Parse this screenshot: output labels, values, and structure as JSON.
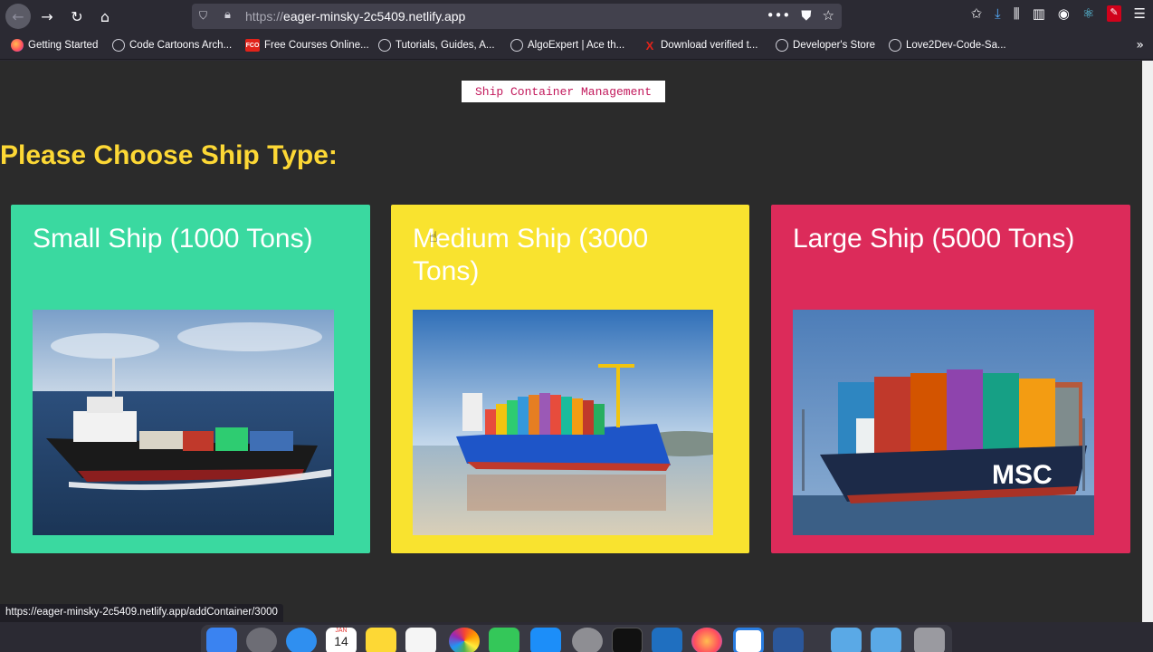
{
  "browser": {
    "url_prefix": "https://",
    "url_host": "eager-minsky-2c5409.netlify.app",
    "url_actions": [
      "•••",
      "pocket-icon",
      "star-icon"
    ]
  },
  "bookmarks": [
    {
      "label": "Getting Started",
      "icon": "firefox-icon"
    },
    {
      "label": "Code Cartoons Arch...",
      "icon": "globe-icon"
    },
    {
      "label": "Free Courses Online...",
      "icon": "fco-icon",
      "icon_text": "FCO"
    },
    {
      "label": "Tutorials, Guides, A...",
      "icon": "globe-icon"
    },
    {
      "label": "AlgoExpert | Ace th...",
      "icon": "globe-icon"
    },
    {
      "label": "Download verified t...",
      "icon": "x-icon",
      "icon_text": "X"
    },
    {
      "label": "Developer's Store",
      "icon": "globe-icon"
    },
    {
      "label": "Love2Dev-Code-Sa...",
      "icon": "globe-icon"
    }
  ],
  "page": {
    "app_title": "Ship Container Management",
    "heading": "Please Choose Ship Type:",
    "cards": [
      {
        "title": "Small Ship (1000 Tons)",
        "color": "#3ad9a0"
      },
      {
        "title": "Medium Ship (3000 Tons)",
        "color": "#f9e32f"
      },
      {
        "title": "Large Ship (5000 Tons)",
        "color": "#dc2b5a"
      }
    ]
  },
  "status_bar": {
    "link_url": "https://eager-minsky-2c5409.netlify.app/addContainer/3000"
  },
  "dock": {
    "calendar_month": "JAN",
    "calendar_day": "14"
  }
}
